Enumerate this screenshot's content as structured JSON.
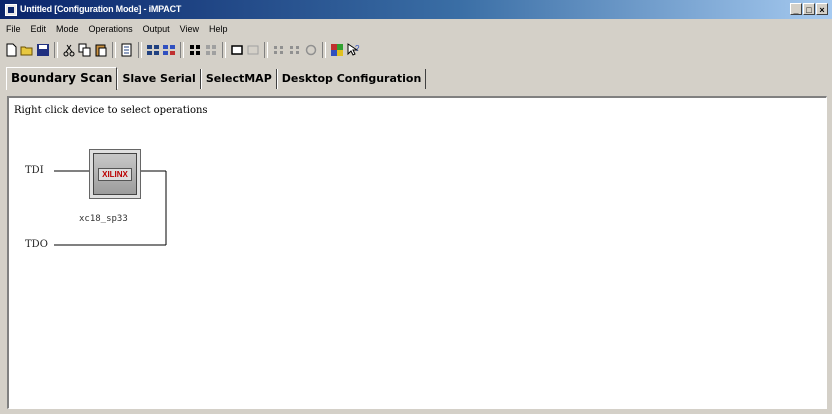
{
  "window": {
    "title": "Untitled [Configuration Mode] - iMPACT",
    "buttons": {
      "minimize": "_",
      "maximize": "□",
      "close": "×"
    }
  },
  "menu": [
    "File",
    "Edit",
    "Mode",
    "Operations",
    "Output",
    "View",
    "Help"
  ],
  "toolbar": {
    "icons": [
      "new-icon",
      "open-icon",
      "save-icon",
      "cut-icon",
      "copy-icon",
      "paste-icon",
      "page-icon",
      "grid-icon",
      "program-icon",
      "chain-icon",
      "chain-disabled-icon",
      "device-icon",
      "device-disabled-icon",
      "scan-icon",
      "scan2-icon",
      "refresh-icon",
      "color-icon",
      "help-pointer-icon"
    ]
  },
  "tabs": [
    {
      "label": "Boundary Scan",
      "active": true
    },
    {
      "label": "Slave Serial",
      "active": false
    },
    {
      "label": "SelectMAP",
      "active": false
    },
    {
      "label": "Desktop Configuration",
      "active": false
    }
  ],
  "canvas": {
    "hint": "Right click device to select operations",
    "tdi": "TDI",
    "tdo": "TDO",
    "device": {
      "logo": "XILINX",
      "name": "xc18_sp33"
    }
  },
  "colors": {
    "titlebar_start": "#0a246a",
    "titlebar_end": "#a6caf0",
    "chrome": "#d4d0c8",
    "canvas": "#ffffff"
  }
}
